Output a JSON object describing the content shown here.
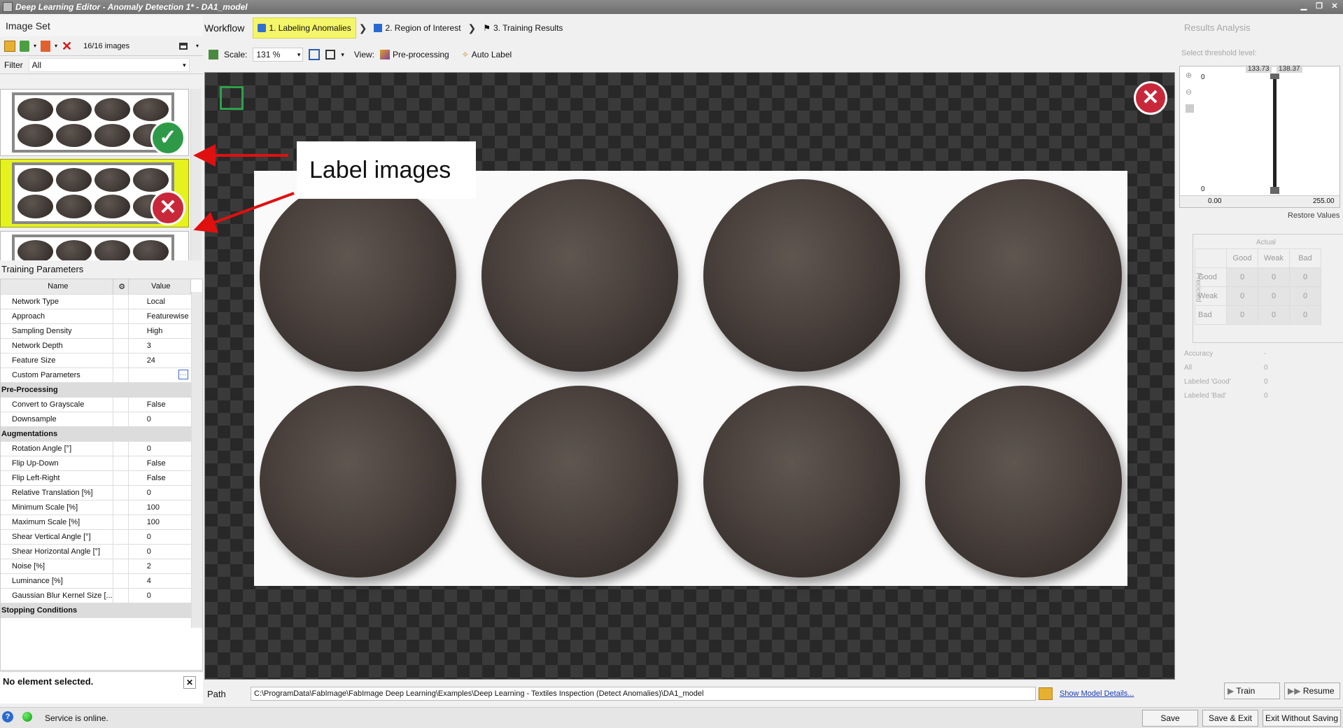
{
  "window": {
    "title": "Deep Learning Editor - Anomaly Detection 1* - DA1_model"
  },
  "image_set": {
    "header": "Image Set",
    "count_label": "16/16 images",
    "filter_label": "Filter",
    "filter_value": "All"
  },
  "callout": {
    "text": "Label images"
  },
  "training_parameters": {
    "header": "Training Parameters",
    "col_name": "Name",
    "col_value": "Value",
    "rows": [
      {
        "name": "Network Type",
        "value": "Local"
      },
      {
        "name": "Approach",
        "value": "Featurewise"
      },
      {
        "name": "Sampling Density",
        "value": "High"
      },
      {
        "name": "Network Depth",
        "value": "3"
      },
      {
        "name": "Feature Size",
        "value": "24"
      },
      {
        "name": "Custom Parameters",
        "value": ""
      }
    ],
    "preprocessing_header": "Pre-Processing",
    "preprocessing": [
      {
        "name": "Convert to Grayscale",
        "value": "False"
      },
      {
        "name": "Downsample",
        "value": "0"
      }
    ],
    "augmentations_header": "Augmentations",
    "augmentations": [
      {
        "name": "Rotation Angle [°]",
        "value": "0"
      },
      {
        "name": "Flip Up-Down",
        "value": "False"
      },
      {
        "name": "Flip Left-Right",
        "value": "False"
      },
      {
        "name": "Relative Translation [%]",
        "value": "0"
      },
      {
        "name": "Minimum Scale [%]",
        "value": "100"
      },
      {
        "name": "Maximum Scale [%]",
        "value": "100"
      },
      {
        "name": "Shear Vertical Angle [°]",
        "value": "0"
      },
      {
        "name": "Shear Horizontal Angle [°]",
        "value": "0"
      },
      {
        "name": "Noise [%]",
        "value": "2"
      },
      {
        "name": "Luminance [%]",
        "value": "4"
      },
      {
        "name": "Gaussian Blur Kernel Size [...",
        "value": "0"
      }
    ],
    "stopping_header": "Stopping Conditions",
    "no_selection": "No element selected."
  },
  "workflow": {
    "label": "Workflow",
    "steps": [
      {
        "label": "1. Labeling Anomalies",
        "active": true
      },
      {
        "label": "2. Region of Interest",
        "active": false
      },
      {
        "label": "3. Training Results",
        "active": false
      }
    ]
  },
  "viewbar": {
    "scale_label": "Scale:",
    "scale_value": "131 %",
    "view_label": "View:",
    "preprocessing": "Pre-processing",
    "auto_label": "Auto Label"
  },
  "results": {
    "header": "Results Analysis",
    "threshold_label": "Select threshold level:",
    "slider_low": "133.73",
    "slider_high": "138.37",
    "y_top": "0",
    "y_bottom": "0",
    "x_min": "0.00",
    "x_max": "255.00",
    "restore": "Restore Values",
    "actual": "Actual",
    "predicted": "Predicted",
    "columns": [
      "Good",
      "Weak",
      "Bad"
    ],
    "matrix": [
      {
        "label": "Good",
        "values": [
          "0",
          "0",
          "0"
        ]
      },
      {
        "label": "Weak",
        "values": [
          "0",
          "0",
          "0"
        ]
      },
      {
        "label": "Bad",
        "values": [
          "0",
          "0",
          "0"
        ]
      }
    ],
    "stats": [
      {
        "label": "Accuracy",
        "value": "-"
      },
      {
        "label": "All",
        "value": "0"
      },
      {
        "label": "Labeled 'Good'",
        "value": "0"
      },
      {
        "label": "Labeled 'Bad'",
        "value": "0"
      }
    ],
    "train": "Train",
    "resume": "Resume"
  },
  "path": {
    "label": "Path",
    "value": "C:\\ProgramData\\FabImage\\FabImage Deep Learning\\Examples\\Deep Learning - Textiles Inspection (Detect Anomalies)\\DA1_model",
    "show_details": "Show Model Details..."
  },
  "status": {
    "service": "Service is online.",
    "save": "Save",
    "save_exit": "Save & Exit",
    "exit_no_save": "Exit Without Saving"
  },
  "colors": {
    "good": "#2e9a48",
    "bad": "#c8283a",
    "active_step": "#f5f56a",
    "arrow": "#e01010"
  }
}
